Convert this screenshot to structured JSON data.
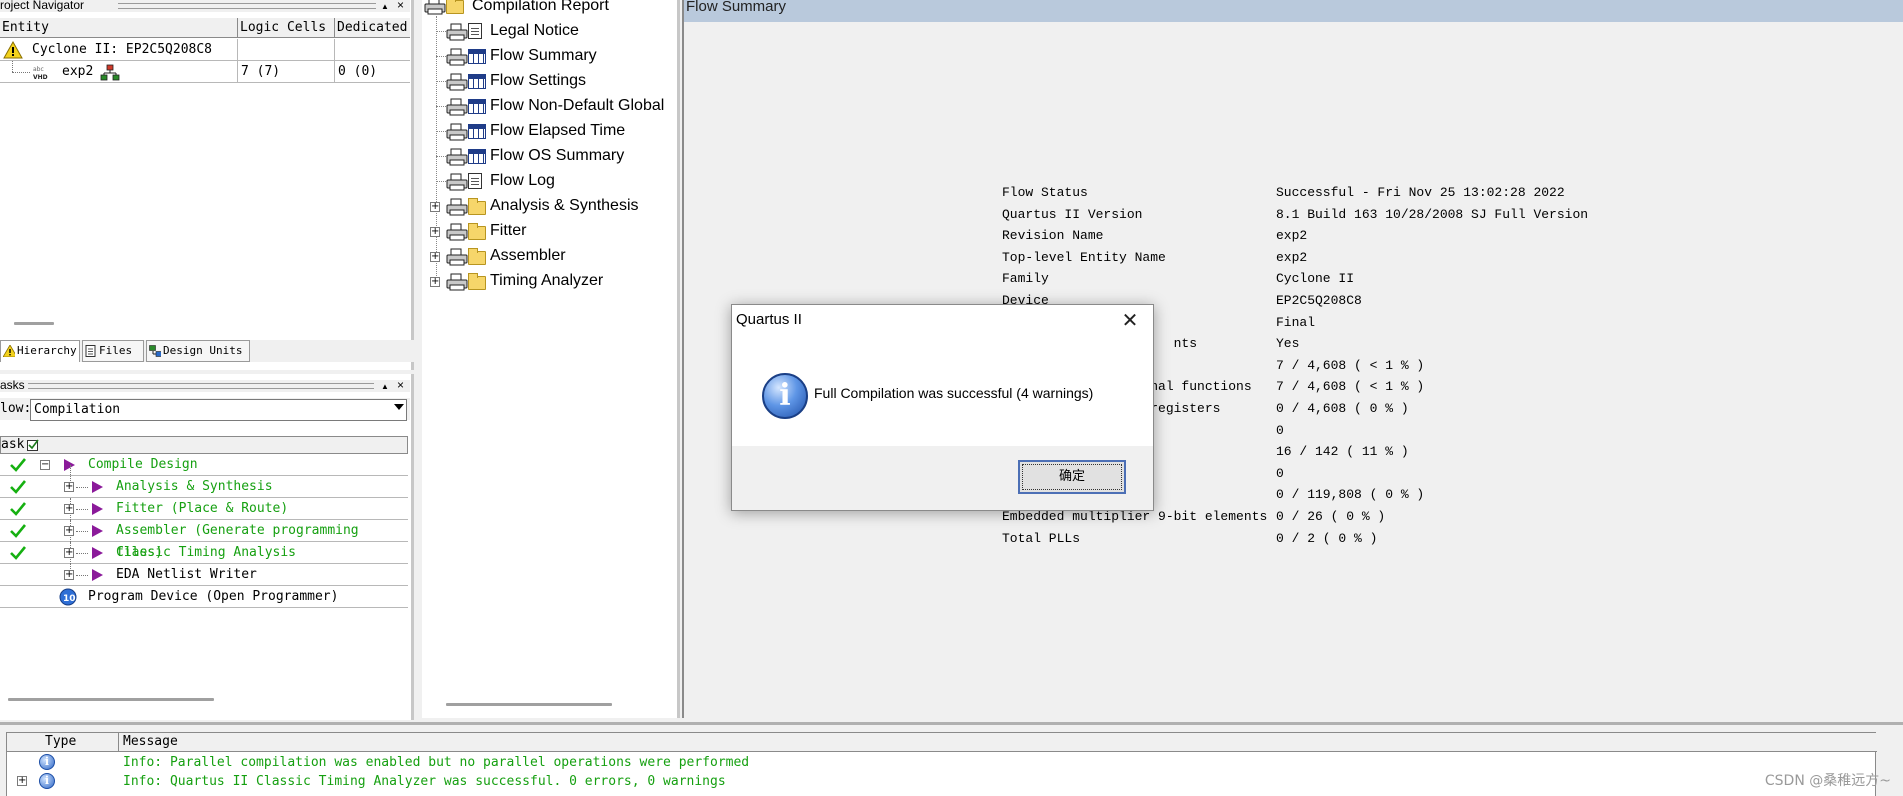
{
  "navigator": {
    "title": "roject Navigator",
    "controls": {
      "pin": "▲",
      "close": "×"
    },
    "columns": [
      "Entity",
      "Logic Cells",
      "Dedicated"
    ],
    "rows": [
      {
        "entity": "Cyclone II: EP2C5Q208C8",
        "logic_cells": "",
        "dedicated": ""
      },
      {
        "entity": "exp2",
        "logic_cells": "7 (7)",
        "dedicated": "0 (0)"
      }
    ],
    "tabs": [
      "Hierarchy",
      "Files",
      "Design Units"
    ]
  },
  "tasks": {
    "title": "asks",
    "controls": {
      "pin": "▲",
      "close": "×"
    },
    "flow_label": "low:",
    "flow_value": "Compilation",
    "column": "ask",
    "items": [
      {
        "label": "Compile Design",
        "done": true,
        "expander": "−"
      },
      {
        "label": "Analysis & Synthesis",
        "done": true,
        "expander": "+"
      },
      {
        "label": "Fitter (Place & Route)",
        "done": true,
        "expander": "+"
      },
      {
        "label": "Assembler (Generate programming files)",
        "done": true,
        "expander": "+"
      },
      {
        "label": "Classic Timing Analysis",
        "done": true,
        "expander": "+"
      },
      {
        "label": "EDA Netlist Writer",
        "done": false,
        "expander": "+"
      },
      {
        "label": "Program Device (Open Programmer)",
        "done": false,
        "expander": ""
      }
    ]
  },
  "report_tree": {
    "root": "Compilation Report",
    "items": [
      {
        "label": "Legal Notice",
        "icon": "document-icon"
      },
      {
        "label": "Flow Summary",
        "icon": "table-icon"
      },
      {
        "label": "Flow Settings",
        "icon": "table-icon"
      },
      {
        "label": "Flow Non-Default Global",
        "icon": "table-icon"
      },
      {
        "label": "Flow Elapsed Time",
        "icon": "table-icon"
      },
      {
        "label": "Flow OS Summary",
        "icon": "table-icon"
      },
      {
        "label": "Flow Log",
        "icon": "document-icon"
      },
      {
        "label": "Analysis & Synthesis",
        "icon": "folder-icon"
      },
      {
        "label": "Fitter",
        "icon": "folder-icon"
      },
      {
        "label": "Assembler",
        "icon": "folder-icon"
      },
      {
        "label": "Timing Analyzer",
        "icon": "folder-icon"
      }
    ]
  },
  "summary": {
    "title": "Flow Summary",
    "rows": [
      {
        "label": "Flow Status",
        "value": "Successful - Fri Nov 25 13:02:28 2022"
      },
      {
        "label": "Quartus II Version",
        "value": "8.1 Build 163 10/28/2008 SJ Full Version"
      },
      {
        "label": "Revision Name",
        "value": "exp2"
      },
      {
        "label": "Top-level Entity Name",
        "value": "exp2"
      },
      {
        "label": "Family",
        "value": "Cyclone II"
      },
      {
        "label": "Device",
        "value": "EP2C5Q208C8"
      },
      {
        "label": "",
        "value": "Final"
      },
      {
        "label": "                      nts",
        "value": "Yes"
      },
      {
        "label": "",
        "value": "7 / 4,608 ( < 1 % )"
      },
      {
        "label": "                   nal functions",
        "value": "7 / 4,608 ( < 1 % )"
      },
      {
        "label": "                   registers",
        "value": "0 / 4,608 ( 0 % )"
      },
      {
        "label": "",
        "value": "0"
      },
      {
        "label": "",
        "value": "16 / 142 ( 11 % )"
      },
      {
        "label": "",
        "value": "0"
      },
      {
        "label": "",
        "value": "0 / 119,808 ( 0 % )"
      },
      {
        "label": "Embedded multiplier 9-bit elements",
        "value": "0 / 26 ( 0 % )"
      },
      {
        "label": "Total PLLs",
        "value": "0 / 2 ( 0 % )"
      }
    ]
  },
  "messages": {
    "columns": [
      "Type",
      "Message"
    ],
    "rows": [
      {
        "text": "Info: Parallel compilation was enabled but no parallel operations were performed",
        "expander": ""
      },
      {
        "text": "Info: Quartus II Classic Timing Analyzer was successful. 0 errors, 0 warnings",
        "expander": "+"
      }
    ]
  },
  "dialog": {
    "title": "Quartus II",
    "close": "✕",
    "message": "Full Compilation was successful (4 warnings)",
    "ok_label": "确定"
  },
  "watermark": "CSDN @桑稚远方~",
  "colors": {
    "success_text": "#16a011",
    "task_arrow": "#8b1a9a",
    "title_bar": "#b9c9dc",
    "dialog_button_border": "#4c6fb5"
  }
}
